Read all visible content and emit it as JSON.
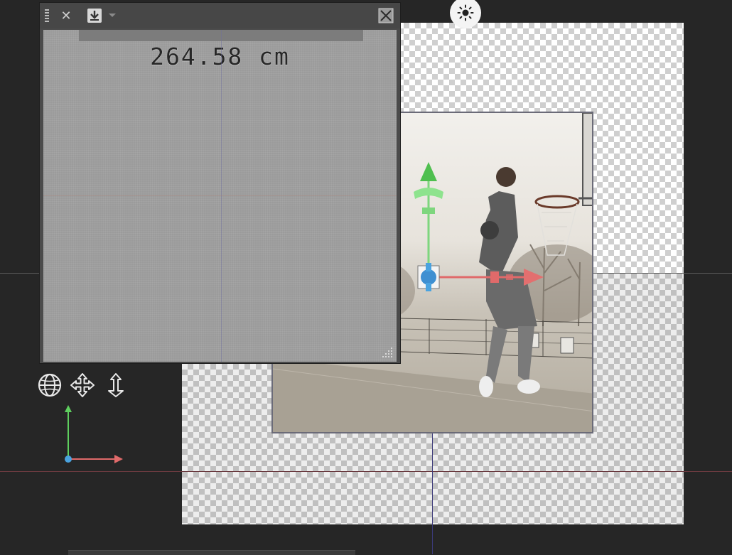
{
  "viewport": {
    "measurement": "264.58 cm",
    "colors": {
      "background": "#262626",
      "x_axis": "#e06a6a",
      "y_axis": "#5ecf5e",
      "z_axis": "#4aa3e0"
    }
  },
  "panel": {
    "toolbar": {
      "grip_icon": "drag-grip-icon",
      "close_icon": "close-icon",
      "save_icon": "download-icon",
      "dropdown_icon": "chevron-down-icon",
      "maximize_icon": "maximize-icon"
    }
  },
  "tools": [
    {
      "name": "world-rotate-tool",
      "icon": "globe-icon"
    },
    {
      "name": "move-tool",
      "icon": "move-arrows-icon"
    },
    {
      "name": "vertical-move-tool",
      "icon": "up-down-arrow-icon"
    }
  ],
  "sun": {
    "icon": "sun-icon"
  }
}
